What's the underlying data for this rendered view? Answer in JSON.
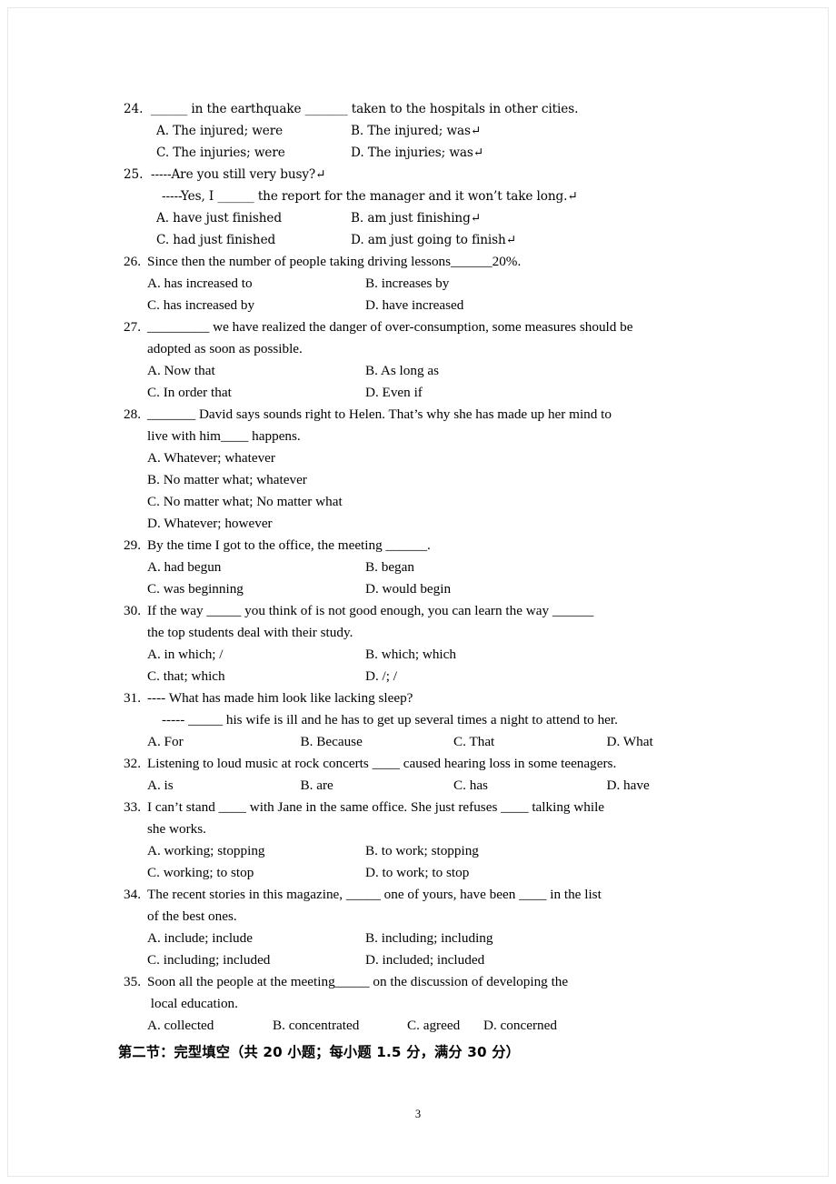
{
  "page": {
    "number": "3",
    "language": "English exam paper, multiple-choice grammar section"
  },
  "questions": [
    {
      "number": "24.",
      "stem": "______ in the earthquake _______ taken to the hospitals in other cities.",
      "continuation": "",
      "style": "legacy",
      "layout": "cols2",
      "options": [
        "A. The injured; were",
        "B. The injured; was↵",
        "C. The injuries; were",
        "D. The injuries; was↵"
      ]
    },
    {
      "number": "25.",
      "stem": "-----Are you still very busy?↵",
      "continuation": "-----Yes, I ______ the report for the manager and it won’t take long.↵",
      "style": "legacy",
      "layout": "cols2",
      "options": [
        "A. have just finished",
        "B. am just finishing↵",
        "C. had just finished",
        "D. am just going to finish↵"
      ]
    },
    {
      "number": "26.",
      "stem": "Since then the number of people taking driving lessons______20%.",
      "continuation": "",
      "style": "normal",
      "layout": "cols2",
      "options": [
        "A. has increased to",
        "B. increases by",
        "C. has increased by",
        "D. have increased"
      ]
    },
    {
      "number": "27.",
      "stem": "_________ we have realized the danger of over-consumption, some measures should be",
      "continuation": "adopted as soon as possible.",
      "style": "normal",
      "layout": "cols2",
      "justify": true,
      "options": [
        "A. Now that",
        "B. As long as",
        "C. In order that",
        "D. Even if"
      ]
    },
    {
      "number": "28.",
      "stem": "_______ David says sounds right to Helen. That’s why she has made up her mind to",
      "continuation": "live with him____ happens.",
      "style": "normal",
      "layout": "stack",
      "options": [
        "A. Whatever; whatever",
        "B. No matter what; whatever",
        "C. No matter what; No matter what",
        "D. Whatever; however"
      ]
    },
    {
      "number": "29.",
      "stem": "By the time I got to the office, the meeting ______.",
      "continuation": "",
      "style": "normal",
      "layout": "cols2",
      "options": [
        "A. had begun",
        "B. began",
        "C. was beginning",
        "D. would begin"
      ]
    },
    {
      "number": "30.",
      "stem": "If the way _____ you think of is not good enough, you can learn the way ______",
      "continuation": "the top students deal with their study.",
      "style": "normal",
      "layout": "cols2",
      "options": [
        "A. in which; /",
        "B. which; which",
        "C. that; which",
        "D. /; /"
      ]
    },
    {
      "number": "31.",
      "stem": "---- What has made him look like lacking sleep?",
      "continuation": "----- _____ his wife is ill and he has to get up several times a night to attend to her.",
      "continuation_indent": true,
      "style": "normal",
      "layout": "cols4",
      "options": [
        "A. For",
        "B. Because",
        "C. That",
        "D. What"
      ]
    },
    {
      "number": "32.",
      "stem": "Listening to loud music at rock concerts ____ caused hearing loss in some teenagers.",
      "continuation": "",
      "style": "normal",
      "layout": "cols4",
      "options": [
        "A. is",
        "B. are",
        "C. has",
        "D. have"
      ]
    },
    {
      "number": "33.",
      "stem": "I can’t stand ____ with Jane in the same office. She just refuses ____ talking while",
      "continuation": "she works.",
      "style": "normal",
      "layout": "cols2",
      "options": [
        "A. working; stopping",
        "B. to work; stopping",
        "C. working; to stop",
        "D. to work; to stop"
      ]
    },
    {
      "number": "34.",
      "stem": "The recent stories in this magazine, _____ one of yours, have been ____ in the list",
      "continuation": "of the best ones.",
      "style": "normal",
      "layout": "cols2",
      "options": [
        "A. include; include",
        "B. including; including",
        "C. including; included",
        "D. included; included"
      ]
    },
    {
      "number": "35.",
      "stem": "Soon all the people at the meeting_____ on the discussion of developing the",
      "continuation": " local education.",
      "style": "normal",
      "layout": "inline4",
      "options": [
        "A. collected",
        "B. concentrated",
        "C. agreed",
        "D. concerned"
      ]
    }
  ],
  "section_header": "第二节：完型填空（共 20 小题；每小题 1.5 分，满分 30 分）"
}
